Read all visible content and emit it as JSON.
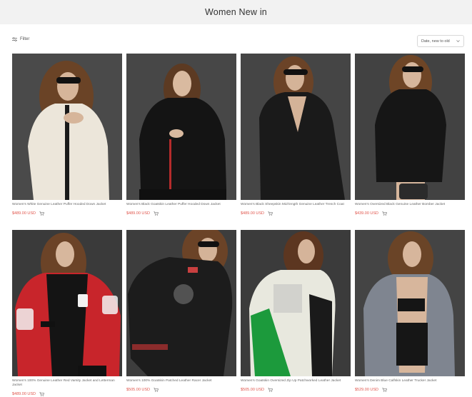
{
  "header": {
    "title": "Women New in"
  },
  "toolbar": {
    "filter_label": "Filter",
    "sort_selected": "Date, new to old"
  },
  "products": [
    {
      "name": "Women's White Genuine Leather Puffer Hooded Down Jacket",
      "price": "$489.00 USD",
      "jacket_color": "#ece6da",
      "bg": "#4a4a4a"
    },
    {
      "name": "Women's Black Goatskin Leather Puffer Hooded Down Jacket",
      "price": "$489.00 USD",
      "jacket_color": "#141414",
      "bg": "#474747"
    },
    {
      "name": "Women's Black Sheepskin Mid-length Genuine Leather Trench Coat",
      "price": "$489.00 USD",
      "jacket_color": "#1a1a1a",
      "bg": "#454545"
    },
    {
      "name": "Women's Oversized Black Genuine Leather Bomber Jacket",
      "price": "$439.00 USD",
      "jacket_color": "#161616",
      "bg": "#424242"
    },
    {
      "name": "Women's 100% Genuine Leather Red Varsity Jacket and Letterman Jacket",
      "price": "$489.00 USD",
      "jacket_color": "#c8252b",
      "bg": "#3a3a3a"
    },
    {
      "name": "Women's 100% Goatskin Patched Leather Racer Jacket",
      "price": "$505.00 USD",
      "jacket_color": "#1c1c1c",
      "bg": "#3d3d3d"
    },
    {
      "name": "Women's Goatskin Oversized Zip Up Patchworked Leather Jacket",
      "price": "$505.00 USD",
      "jacket_color": "#e8e8de",
      "bg": "#3b3b3b"
    },
    {
      "name": "Women's Denim Blue Calfskin Leather Trucker Jacket",
      "price": "$529.00 USD",
      "jacket_color": "#7f8590",
      "bg": "#444444"
    }
  ]
}
